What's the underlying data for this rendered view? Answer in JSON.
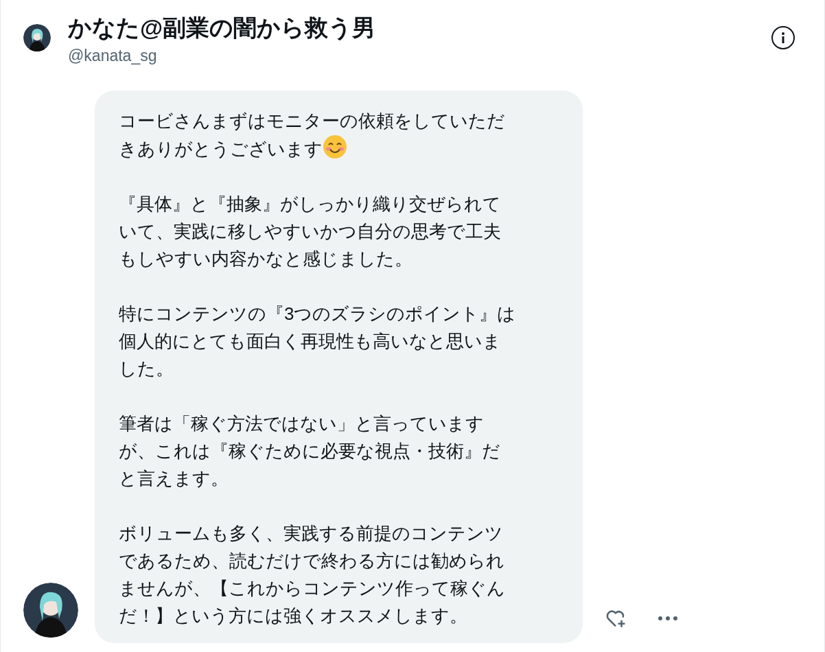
{
  "header": {
    "name": "かなた@副業の闇から救う男",
    "handle": "@kanata_sg"
  },
  "message": {
    "paragraphs": [
      [
        "コービさんまずはモニターの依頼をしていただ",
        "きありがとうございます"
      ],
      [
        "『具体』と『抽象』がしっかり織り交ぜられて",
        "いて、実践に移しやすいかつ自分の思考で工夫",
        "もしやすい内容かなと感じました。"
      ],
      [
        "特にコンテンツの『3つのズラシのポイント』は",
        "個人的にとても面白く再現性も高いなと思いま",
        "した。"
      ],
      [
        "筆者は「稼ぐ方法ではない」と言っています",
        "が、これは『稼ぐために必要な視点・技術』だ",
        "と言えます。"
      ],
      [
        "ボリュームも多く、実践する前提のコンテンツ",
        "であるため、読むだけで終わる方には勧められ",
        "ませんが、【これからコンテンツ作って稼ぐん",
        "だ！】という方には強くオススメします。"
      ]
    ]
  }
}
